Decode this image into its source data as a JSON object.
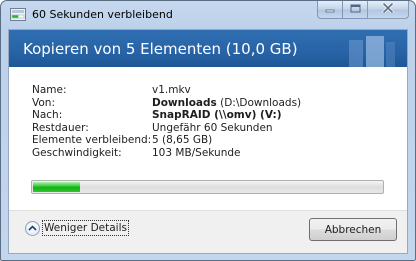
{
  "window": {
    "title": "60 Sekunden verbleibend",
    "title_icon": "copy-progress-icon",
    "caption_buttons": [
      "minimize-icon",
      "maximize-icon",
      "close-icon"
    ]
  },
  "header": {
    "title": "Kopieren von 5 Elementen (10,0 GB)"
  },
  "details": {
    "name": {
      "label": "Name:",
      "value": "v1.mkv"
    },
    "from": {
      "label": "Von:",
      "value_bold": "Downloads",
      "value_rest": " (D:\\Downloads)"
    },
    "to": {
      "label": "Nach:",
      "value_bold": "SnapRAID (\\\\omv) (V:)"
    },
    "remaining_time": {
      "label": "Restdauer:",
      "value": "Ungefähr 60 Sekunden"
    },
    "items_remaining": {
      "label": "Elemente verbleibend:",
      "value": "5 (8,65 GB)"
    },
    "speed": {
      "label": "Geschwindigkeit:",
      "value": "103 MB/Sekunde"
    }
  },
  "progress": {
    "fraction": 0.135,
    "color": "#16b016"
  },
  "footer": {
    "details_toggle_label": "Weniger Details",
    "details_toggle_icon": "chevron-up-icon",
    "cancel_label": "Abbrechen"
  },
  "colors": {
    "header_bg": "#2763a6",
    "window_frame": "#bcd1ea"
  }
}
